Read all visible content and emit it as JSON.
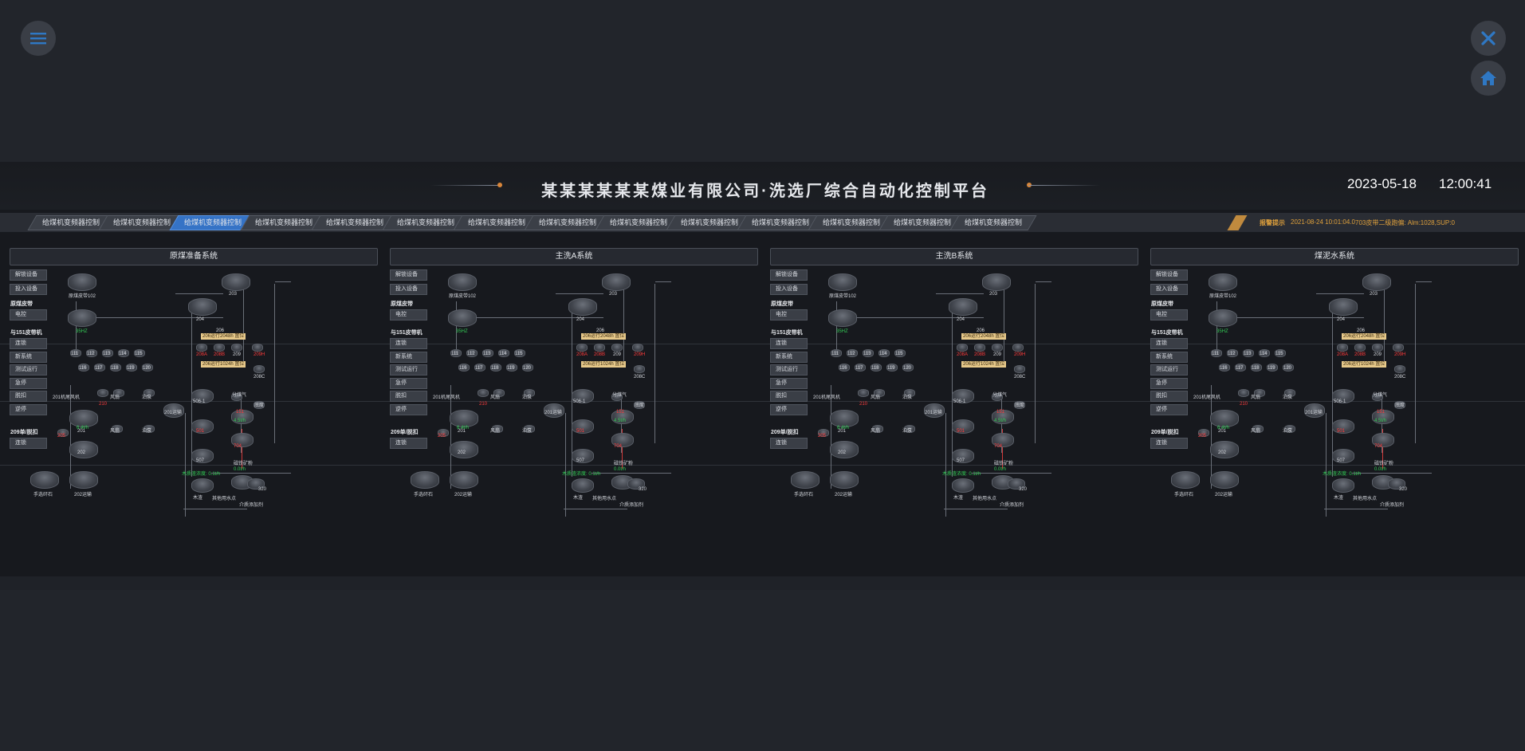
{
  "window_controls": {
    "menu_icon": "hamburger-menu-icon",
    "close_icon": "close-icon",
    "home_icon": "home-icon",
    "accent": "#2f78c4"
  },
  "header": {
    "title": "某某某某某某煤业有限公司·洗选厂综合自动化控制平台",
    "date": "2023-05-18",
    "time": "12:00:41"
  },
  "tabs": [
    {
      "label": "给煤机变频器控制"
    },
    {
      "label": "给煤机变频器控制"
    },
    {
      "label": "给煤机变频器控制"
    },
    {
      "label": "给煤机变频器控制"
    },
    {
      "label": "给煤机变频器控制"
    },
    {
      "label": "给煤机变频器控制"
    },
    {
      "label": "给煤机变频器控制"
    },
    {
      "label": "给煤机变频器控制"
    },
    {
      "label": "给煤机变频器控制"
    },
    {
      "label": "给煤机变频器控制"
    },
    {
      "label": "给煤机变频器控制"
    },
    {
      "label": "给煤机变频器控制"
    },
    {
      "label": "给煤机变频器控制"
    },
    {
      "label": "给煤机变频器控制"
    }
  ],
  "active_tab_index": 2,
  "alarm": {
    "label": "报警提示",
    "time": "2021-08-24 10:01:04.0",
    "message": "703皮带二级跑偏: Alm:1028,SUP:0"
  },
  "panels": [
    {
      "title": "原煤准备系统"
    },
    {
      "title": "主洗A系统"
    },
    {
      "title": "主洗B系统"
    },
    {
      "title": "煤泥水系统"
    }
  ],
  "controls": {
    "btn_unlock": "解锁设备",
    "btn_commission": "投入设备",
    "label_raw_belt": "原煤皮带",
    "btn_inching": "电控",
    "label_151": "与151皮带机",
    "btn_interlock": "连锁",
    "btn_new_system": "新系统",
    "btn_test_run": "测试运行",
    "btn_emergency": "急停",
    "btn_reset": "脱扣",
    "btn_reverse": "逆停",
    "label_209": "209单/脱扣",
    "btn_interlock2": "连锁"
  },
  "equipment": {
    "belt_102": "原煤皮带102",
    "n203": "203",
    "n204": "204",
    "n206": "206",
    "hz": "35HZ",
    "n111": "111",
    "n112": "112",
    "n113": "113",
    "n114": "114",
    "n115": "115",
    "n116": "116",
    "n117": "117",
    "n118": "118",
    "n119": "119",
    "n120": "120",
    "badge_206_a": "206运行2048h 置位",
    "badge_206_b": "206运行1024h 置位",
    "n208a": "208A",
    "n208b": "208B",
    "n209": "209",
    "n209h": "209H",
    "n208c": "208C",
    "fan201": "201机尾风机",
    "fan": "风扇",
    "pump": "泊泵",
    "n201": "201",
    "n210": "210",
    "n201_belt": "201运输",
    "n5061": "506-1",
    "split": "分煤气",
    "bottom": "底度",
    "n151": "151",
    "rate_a": "6.4t/h",
    "rate_b": "4.5t/h",
    "n205": "205",
    "n202": "202",
    "n501": "501",
    "n704": "704",
    "n507": "507",
    "magnet": "磁铁矿粉",
    "density": "木质渣浓度: 0.1t/h",
    "rate_c": "0.0t/h",
    "stone": "手选矸石",
    "n202_belt": "202运输",
    "n320": "320",
    "wood": "木渣",
    "water_pt": "其他用水点",
    "medium": "介质添加剂"
  }
}
